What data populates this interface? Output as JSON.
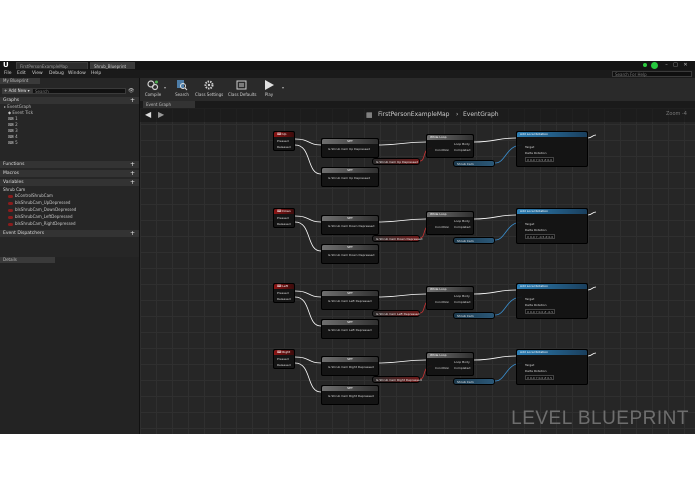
{
  "window": {
    "tabs": [
      "FirstPersonExampleMap",
      "Shrub_Blueprint"
    ],
    "controls": [
      "–",
      "□",
      "✕"
    ]
  },
  "menu": {
    "items": [
      "File",
      "Edit",
      "View",
      "Debug",
      "Window",
      "Help"
    ],
    "search_placeholder": "Search For Help"
  },
  "toolbar": {
    "buttons": [
      "Compile",
      "Search",
      "Class Settings",
      "Class Defaults",
      "Play"
    ]
  },
  "mybp": {
    "tab": "My Blueprint",
    "add_new": "+ Add New ▾",
    "search_placeholder": "Search",
    "graphs_header": "Graphs",
    "graph_items": [
      "EventGraph",
      "Event Tick",
      "1",
      "2",
      "3",
      "4",
      "5"
    ],
    "functions": "Functions",
    "macros": "Macros",
    "variables": "Variables",
    "var_category": "Shrub Cam",
    "var_items": [
      "bControlShrubCam",
      "bIsShrubCam_UpDepressed",
      "bIsShrubCam_DownDepressed",
      "bIsShrubCam_LeftDepressed",
      "bIsShrubCam_RightDepressed"
    ],
    "dispatchers": "Event Dispatchers"
  },
  "details": {
    "tab": "Details"
  },
  "graph": {
    "tab": "Event Graph",
    "breadcrumb_map": "FirstPersonExampleMap",
    "breadcrumb_sep": "›",
    "breadcrumb_graph": "EventGraph",
    "zoom": "Zoom -4",
    "watermark": "LEVEL BLUEPRINT"
  },
  "rows": [
    {
      "key": "Up",
      "pressed": "Pressed",
      "released": "Released",
      "set": "SET",
      "set_top": "Is Shrub Cam Up Depressed",
      "set_bottom": "Is Shrub Cam Up Depressed",
      "var_node": "Is Shrub Cam Up Depressed",
      "branch": "While Loop",
      "loop_body": "Loop Body",
      "condition": "Condition",
      "completed": "Completed",
      "bool_node": "Shrub Cam",
      "add_title": "Add Local Rotation",
      "target": "Target",
      "delta": "Delta Rotation",
      "vec": "X 0.0  Y 0.5  Z 0.0"
    },
    {
      "key": "Down",
      "pressed": "Pressed",
      "released": "Released",
      "set": "SET",
      "set_top": "Is Shrub Cam Down Depressed",
      "set_bottom": "Is Shrub Cam Down Depressed",
      "var_node": "Is Shrub Cam Down Depressed",
      "branch": "While Loop",
      "loop_body": "Loop Body",
      "condition": "Condition",
      "completed": "Completed",
      "bool_node": "Shrub Cam",
      "add_title": "Add Local Rotation",
      "target": "Target",
      "delta": "Delta Rotation",
      "vec": "X 0.0  Y -0.5  Z 0.0"
    },
    {
      "key": "Left",
      "pressed": "Pressed",
      "released": "Released",
      "set": "SET",
      "set_top": "Is Shrub Cam Left Depressed",
      "set_bottom": "Is Shrub Cam Left Depressed",
      "var_node": "Is Shrub Cam Left Depressed",
      "branch": "While Loop",
      "loop_body": "Loop Body",
      "condition": "Condition",
      "completed": "Completed",
      "bool_node": "Shrub Cam",
      "add_title": "Add Local Rotation",
      "target": "Target",
      "delta": "Delta Rotation",
      "vec": "X 0.0  Y 0.0  Z -0.5"
    },
    {
      "key": "Right",
      "pressed": "Pressed",
      "released": "Released",
      "set": "SET",
      "set_top": "Is Shrub Cam Right Depressed",
      "set_bottom": "Is Shrub Cam Right Depressed",
      "var_node": "Is Shrub Cam Right Depressed",
      "branch": "While Loop",
      "loop_body": "Loop Body",
      "condition": "Condition",
      "completed": "Completed",
      "bool_node": "Shrub Cam",
      "add_title": "Add Local Rotation",
      "target": "Target",
      "delta": "Delta Rotation",
      "vec": "X 0.0  Y 0.0  Z 0.5"
    }
  ]
}
